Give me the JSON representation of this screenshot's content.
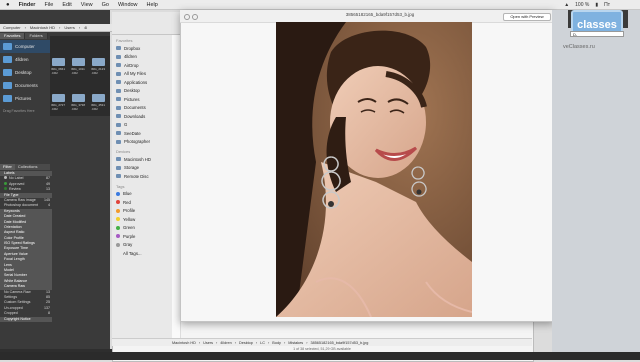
{
  "menubar": {
    "apple": "",
    "items": [
      "Finder",
      "File",
      "Edit",
      "View",
      "Go",
      "Window",
      "Help"
    ],
    "status": "100 %",
    "time": "Пт"
  },
  "path": [
    "Computer",
    "Macintosh HD",
    "Users",
    "4l"
  ],
  "left": {
    "tabs": [
      "Favorites",
      "Folders"
    ],
    "favorites": [
      "Computer",
      "4lldren",
      "Desktop",
      "Documents",
      "Pictures"
    ],
    "drag_hint": "Drag Favorites Here",
    "thumb_labels": [
      "IMG_0841 .CR2",
      "IMG_1011 .CR2",
      "IMG_2123 .CR2",
      "IMG_2727 .CR2",
      "IMG_3738 .CR2",
      "IMG_4531 .CR2"
    ],
    "filter_tabs": [
      "Filter",
      "Collections"
    ],
    "filters": [
      {
        "label": "Labels",
        "count": "",
        "hdr": true
      },
      {
        "label": "No Label",
        "count": "87",
        "color": "#bbbbbb"
      },
      {
        "label": "Approved",
        "count": "49",
        "color": "#3b9b3b"
      },
      {
        "label": "Review",
        "count": "13",
        "color": "#2f7d2f"
      },
      {
        "label": "File Type",
        "count": "",
        "hdr": true
      },
      {
        "label": "Camera Raw image",
        "count": "145"
      },
      {
        "label": "Photoshop document",
        "count": "4"
      },
      {
        "label": "Keywords",
        "count": "",
        "hdr": true
      },
      {
        "label": "Date Created",
        "count": "",
        "hdr": true
      },
      {
        "label": "Date Modified",
        "count": "",
        "hdr": true
      },
      {
        "label": "Orientation",
        "count": "",
        "hdr": true
      },
      {
        "label": "Aspect Ratio",
        "count": "",
        "hdr": true
      },
      {
        "label": "Color Profile",
        "count": "",
        "hdr": true
      },
      {
        "label": "ISO Speed Ratings",
        "count": "",
        "hdr": true
      },
      {
        "label": "Exposure Time",
        "count": "",
        "hdr": true
      },
      {
        "label": "Aperture Value",
        "count": "",
        "hdr": true
      },
      {
        "label": "Focal Length",
        "count": "",
        "hdr": true
      },
      {
        "label": "Lens",
        "count": "",
        "hdr": true
      },
      {
        "label": "Model",
        "count": "",
        "hdr": true
      },
      {
        "label": "Serial Number",
        "count": "",
        "hdr": true
      },
      {
        "label": "White Balance",
        "count": "",
        "hdr": true
      },
      {
        "label": "Camera Raw",
        "count": "",
        "hdr": true
      },
      {
        "label": "No Camera Raw",
        "count": "13"
      },
      {
        "label": "Settings",
        "count": "85"
      },
      {
        "label": "Custom Settings",
        "count": "25"
      },
      {
        "label": "Un-cropped",
        "count": "137"
      },
      {
        "label": "Cropped",
        "count": "8"
      },
      {
        "label": "Copyright Notice",
        "count": "",
        "hdr": true
      }
    ],
    "status": "1 items, 227 hidden, 1 selected - 20.39 MB"
  },
  "finder": {
    "sidebar_sections": [
      {
        "header": "Favorites",
        "items": [
          "Dropbox",
          "4lldren",
          "AirDrop",
          "All My Files",
          "Applications",
          "Desktop",
          "Pictures",
          "Documents",
          "Downloads",
          "G",
          "SeeDate",
          "Photographer"
        ]
      },
      {
        "header": "Devices",
        "items": [
          "Macintosh HD",
          "Storage",
          "Remote Disc"
        ]
      },
      {
        "header": "Tags",
        "items": [
          "Blue",
          "Red",
          "Profile",
          "Yellow",
          "Green",
          "Purple",
          "Gray",
          "All Tags..."
        ]
      }
    ],
    "tag_colors": [
      "#3b7be0",
      "#e0443b",
      "#f39a2b",
      "#f2cf2b",
      "#45b045",
      "#a65ac4",
      "#9a9a9a",
      ""
    ],
    "pathbar": [
      "Macintosh HD",
      "Users",
      "4lldren",
      "Desktop",
      "LC",
      "Body",
      "Mistakes",
      "38565182165_bda9f157d53_b.jpg"
    ],
    "status": "1 of 38 selected, 51,29 GB available"
  },
  "quicklook": {
    "title": "38565182165_bda9f157d53_b.jpg",
    "open_button": "Open with Preview"
  },
  "right": {
    "watermark": "classes",
    "site": "veClasses.ru",
    "dropdown": "D-"
  }
}
